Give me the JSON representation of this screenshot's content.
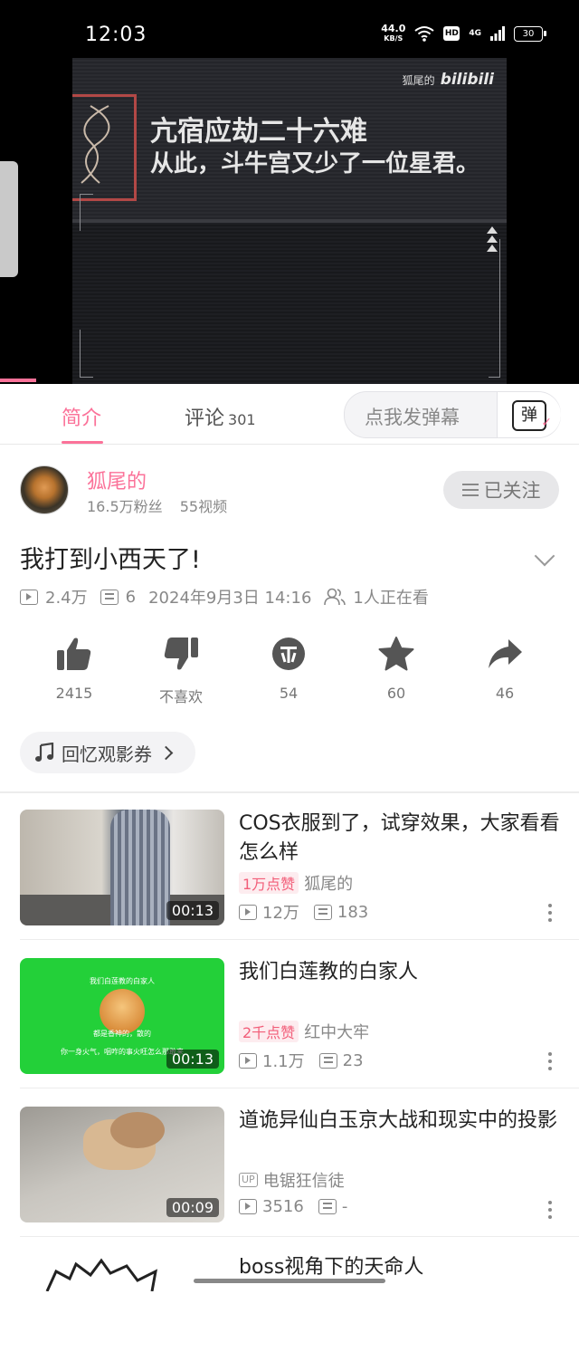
{
  "status_bar": {
    "time": "12:03",
    "net_speed": "44.0",
    "net_unit": "KB/S",
    "hd": "HD",
    "signal": "4G",
    "battery": "30"
  },
  "video": {
    "watermark_text": "狐尾的",
    "watermark_logo": "bilibili",
    "line1": "亢宿应劫二十六难",
    "line2": "从此，斗牛宫又少了一位星君。"
  },
  "tabs": {
    "intro": "简介",
    "comments": "评论",
    "comments_count": "301",
    "danmaku_placeholder": "点我发弹幕",
    "danmaku_icon": "弹"
  },
  "uploader": {
    "name": "狐尾的",
    "fans": "16.5万粉丝",
    "videos": "55视频",
    "follow_label": "已关注"
  },
  "video_info": {
    "title": "我打到小西天了!",
    "views": "2.4万",
    "danmaku": "6",
    "date": "2024年9月3日 14:16",
    "watching": "1人正在看"
  },
  "actions": [
    {
      "icon": "thumbs-up-icon",
      "label": "2415"
    },
    {
      "icon": "thumbs-down-icon",
      "label": "不喜欢"
    },
    {
      "icon": "coin-icon",
      "label": "54"
    },
    {
      "icon": "star-icon",
      "label": "60"
    },
    {
      "icon": "share-icon",
      "label": "46"
    }
  ],
  "coupon": {
    "label": "回忆观影券"
  },
  "related": [
    {
      "title": "COS衣服到了，试穿效果，大家看看怎么样",
      "tag": "1万点赞",
      "author": "狐尾的",
      "views": "12万",
      "danmaku": "183",
      "duration": "00:13"
    },
    {
      "title": "我们白莲教的白家人",
      "tag": "2千点赞",
      "author": "红中大牢",
      "views": "1.1万",
      "danmaku": "23",
      "duration": "00:13",
      "thumb_text_top": "我们白莲教的白家人",
      "thumb_text_mid": "都是香神的，散的",
      "thumb_text_bottom": "你一身火气，咽咋的事火旺怎么那敢来"
    },
    {
      "title": "道诡异仙白玉京大战和现实中的投影",
      "up_badge": "UP",
      "author": "电锯狂信徒",
      "views": "3516",
      "danmaku": "-",
      "duration": "00:09"
    },
    {
      "title": "boss视角下的天命人"
    }
  ],
  "colors": {
    "accent": "#fb7299",
    "text": "#222222",
    "muted": "#888888"
  }
}
